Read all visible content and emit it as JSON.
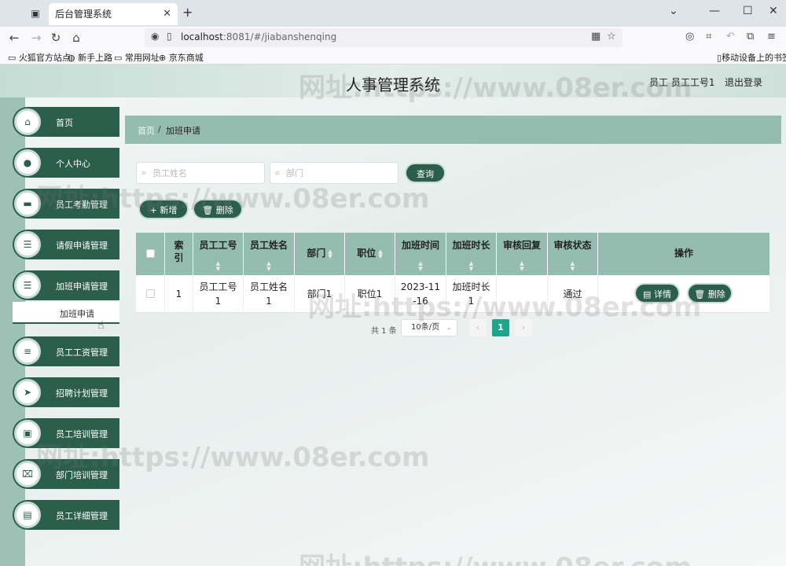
{
  "browser": {
    "tab_title": "后台管理系统",
    "url_host": "localhost",
    "url_path": ":8081/#/jiabanshenqing",
    "bookmarks": [
      "火狐官方站点",
      "新手上路",
      "常用网址",
      "京东商城"
    ],
    "mobile_bookmarks": "移动设备上的书签"
  },
  "header": {
    "title": "人事管理系统",
    "user": "员工 员工工号1",
    "logout": "退出登录"
  },
  "sidebar": {
    "items": [
      {
        "label": "首页",
        "icon": "home-icon"
      },
      {
        "label": "个人中心",
        "icon": "user-icon"
      },
      {
        "label": "员工考勤管理",
        "icon": "monitor-icon"
      },
      {
        "label": "请假申请管理",
        "icon": "list-icon"
      },
      {
        "label": "加班申请管理",
        "icon": "menu-icon"
      },
      {
        "label": "员工工资管理",
        "icon": "sliders-icon"
      },
      {
        "label": "招聘计划管理",
        "icon": "send-icon"
      },
      {
        "label": "员工培训管理",
        "icon": "briefcase-icon"
      },
      {
        "label": "部门培训管理",
        "icon": "clipboard-x-icon"
      },
      {
        "label": "员工详细管理",
        "icon": "clipboard-icon"
      }
    ],
    "submenu_label": "加班申请"
  },
  "breadcrumb": {
    "home": "首页",
    "separator": "/",
    "current": "加班申请"
  },
  "search": {
    "name_placeholder": "员工姓名",
    "dept_placeholder": "部门",
    "button": "查询"
  },
  "actions": {
    "add": "新增",
    "delete": "删除"
  },
  "table": {
    "headers": [
      "索引",
      "员工工号",
      "员工姓名",
      "部门",
      "职位",
      "加班时间",
      "加班时长",
      "审核回复",
      "审核状态",
      "操作"
    ],
    "rows": [
      {
        "index": "1",
        "emp_no": "员工工号1",
        "emp_name": "员工姓名1",
        "dept": "部门1",
        "position": "职位1",
        "time": "2023-11-16",
        "duration": "加班时长1",
        "reply": "",
        "status": "通过",
        "detail_btn": "详情",
        "delete_btn": "删除"
      }
    ]
  },
  "pagination": {
    "total": "共 1 条",
    "page_size": "10条/页",
    "current_page": "1"
  },
  "watermark": "网址:https://www.08er.com",
  "colors": {
    "primary": "#2c5e4c",
    "header_bg": "#94bdb0",
    "page_active": "#1fa58b"
  }
}
